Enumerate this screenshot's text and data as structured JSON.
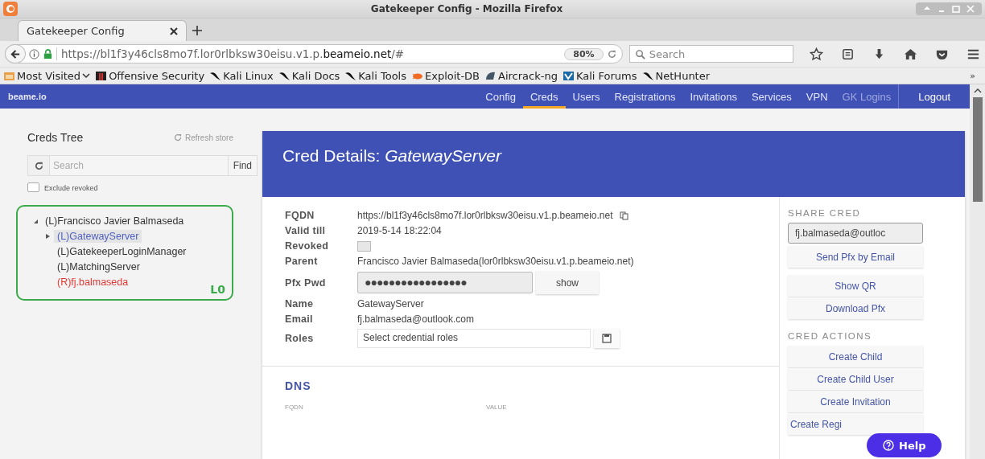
{
  "window": {
    "title": "Gatekeeper Config - Mozilla Firefox"
  },
  "tabs": [
    {
      "label": "Gatekeeper Config",
      "selected": true
    }
  ],
  "toolbar": {
    "url": "https://bl1f3y46cls8mo7f.lor0rlbksw30eisu.v1.p.**beameio.net**/#",
    "zoom": "80%",
    "search_placeholder": "Search"
  },
  "bookmarks": [
    {
      "label": "Most Visited",
      "kind": "folder"
    },
    {
      "label": "Offensive Security",
      "kind": "offsec"
    },
    {
      "label": "Kali Linux",
      "kind": "kali"
    },
    {
      "label": "Kali Docs",
      "kind": "kali"
    },
    {
      "label": "Kali Tools",
      "kind": "kali"
    },
    {
      "label": "Exploit-DB",
      "kind": "exploit"
    },
    {
      "label": "Aircrack-ng",
      "kind": "aircrack"
    },
    {
      "label": "Kali Forums",
      "kind": "forums"
    },
    {
      "label": "NetHunter",
      "kind": "kali"
    }
  ],
  "bookmarks_overflow": "»",
  "app_nav": {
    "brand": "beame.io",
    "items": [
      {
        "label": "Config",
        "selected": false,
        "disabled": false
      },
      {
        "label": "Creds",
        "selected": true,
        "disabled": false
      },
      {
        "label": "Users",
        "selected": false,
        "disabled": false
      },
      {
        "label": "Registrations",
        "selected": false,
        "disabled": false
      },
      {
        "label": "Invitations",
        "selected": false,
        "disabled": false
      },
      {
        "label": "Services",
        "selected": false,
        "disabled": false
      },
      {
        "label": "VPN",
        "selected": false,
        "disabled": false
      },
      {
        "label": "GK Logins",
        "selected": false,
        "disabled": true
      }
    ],
    "logout": "Logout"
  },
  "sidebar": {
    "title": "Creds Tree",
    "refresh": "Refresh store",
    "search_placeholder": "Search",
    "find": "Find",
    "exclude_revoked": {
      "label": "Exclude revoked",
      "checked": false
    },
    "annotation": "L0",
    "tree": [
      {
        "label": "(L)Francisco Javier Balmaseda",
        "expanded": true,
        "selected": false,
        "revoked": false,
        "children": [
          {
            "label": "(L)GatewayServer",
            "expanded": false,
            "selected": true,
            "revoked": false
          },
          {
            "label": "(L)GatekeeperLoginManager",
            "selected": false,
            "revoked": false
          },
          {
            "label": "(L)MatchingServer",
            "selected": false,
            "revoked": false
          },
          {
            "label": "(R)fj.balmaseda",
            "selected": false,
            "revoked": true
          }
        ]
      }
    ]
  },
  "details": {
    "title": "Cred Details: *GatewayServer*",
    "fields": [
      {
        "kind": "text",
        "label": "FQDN",
        "value": "https://bl1f3y46cls8mo7f.lor0rlbksw30eisu.v1.p.beameio.net",
        "copy": true
      },
      {
        "kind": "text",
        "label": "Valid till",
        "value": "2019-5-14 18:22:04"
      },
      {
        "kind": "checkbox",
        "label": "Revoked",
        "checked": false
      },
      {
        "kind": "text",
        "label": "Parent",
        "value": "Francisco Javier Balmaseda(lor0rlbksw30eisu.v1.p.beameio.net)"
      },
      {
        "kind": "password",
        "label": "Pfx Pwd",
        "value": "●●●●●●●●●●●●●●●●●",
        "button": "show"
      },
      {
        "kind": "text",
        "label": "Name",
        "value": "GatewayServer"
      },
      {
        "kind": "text",
        "label": "Email",
        "value": "fj.balmaseda@outlook.com"
      },
      {
        "kind": "select",
        "label": "Roles",
        "placeholder": "Select credential roles"
      }
    ],
    "dns": {
      "title": "DNS",
      "columns": [
        "FQDN",
        "VALUE"
      ]
    },
    "share": {
      "title": "SHARE CRED",
      "email": "fj.balmaseda@outloc",
      "send": "Send Pfx by Email",
      "group": [
        "Show QR",
        "Download Pfx"
      ]
    },
    "actions": {
      "title": "CRED ACTIONS",
      "items": [
        "Create Child",
        "Create Child User",
        "Create Invitation",
        "Create Regi"
      ]
    }
  },
  "help": "Help"
}
